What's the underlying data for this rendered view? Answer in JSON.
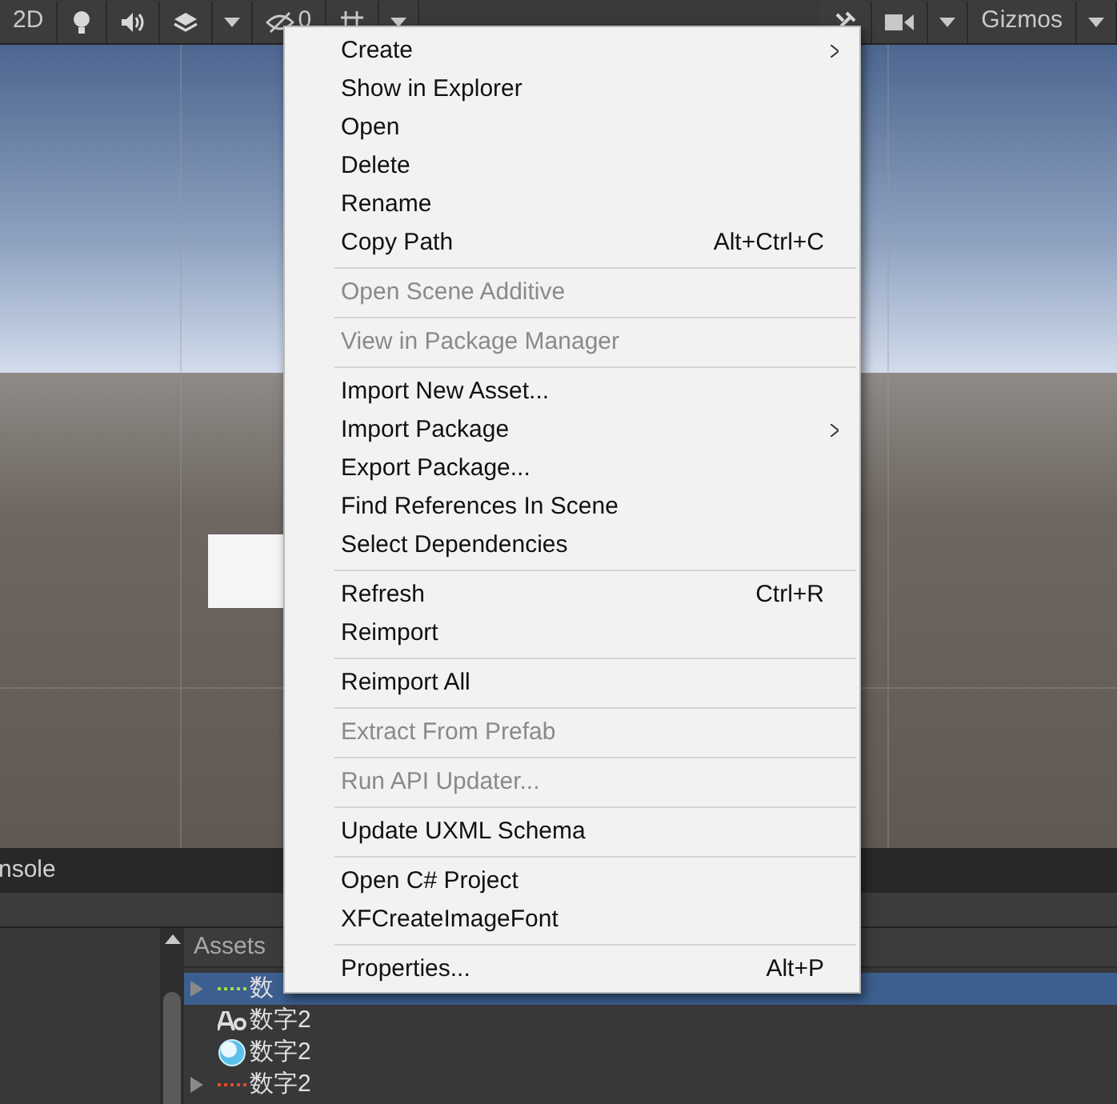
{
  "toolbar": {
    "left": [
      {
        "kind": "text",
        "label": "2D"
      },
      {
        "kind": "bulb"
      },
      {
        "kind": "speaker"
      },
      {
        "kind": "layers"
      },
      {
        "kind": "dropdown"
      },
      {
        "kind": "hidden",
        "label": "0"
      },
      {
        "kind": "grid"
      },
      {
        "kind": "dropdown"
      }
    ],
    "right": [
      {
        "kind": "tools"
      },
      {
        "kind": "camera"
      },
      {
        "kind": "dropdown"
      },
      {
        "kind": "text",
        "label": "Gizmos"
      },
      {
        "kind": "dropdown"
      }
    ]
  },
  "context_menu": [
    {
      "kind": "item",
      "label": "Create",
      "submenu": true,
      "disabled": false
    },
    {
      "kind": "item",
      "label": "Show in Explorer",
      "disabled": false
    },
    {
      "kind": "item",
      "label": "Open",
      "disabled": false
    },
    {
      "kind": "item",
      "label": "Delete",
      "disabled": false
    },
    {
      "kind": "item",
      "label": "Rename",
      "disabled": false
    },
    {
      "kind": "item",
      "label": "Copy Path",
      "shortcut": "Alt+Ctrl+C",
      "disabled": false
    },
    {
      "kind": "separator"
    },
    {
      "kind": "item",
      "label": "Open Scene Additive",
      "disabled": true
    },
    {
      "kind": "separator"
    },
    {
      "kind": "item",
      "label": "View in Package Manager",
      "disabled": true
    },
    {
      "kind": "separator"
    },
    {
      "kind": "item",
      "label": "Import New Asset...",
      "disabled": false
    },
    {
      "kind": "item",
      "label": "Import Package",
      "submenu": true,
      "disabled": false
    },
    {
      "kind": "item",
      "label": "Export Package...",
      "disabled": false
    },
    {
      "kind": "item",
      "label": "Find References In Scene",
      "disabled": false
    },
    {
      "kind": "item",
      "label": "Select Dependencies",
      "disabled": false
    },
    {
      "kind": "separator"
    },
    {
      "kind": "item",
      "label": "Refresh",
      "shortcut": "Ctrl+R",
      "disabled": false
    },
    {
      "kind": "item",
      "label": "Reimport",
      "disabled": false
    },
    {
      "kind": "separator"
    },
    {
      "kind": "item",
      "label": "Reimport All",
      "disabled": false
    },
    {
      "kind": "separator"
    },
    {
      "kind": "item",
      "label": "Extract From Prefab",
      "disabled": true
    },
    {
      "kind": "separator"
    },
    {
      "kind": "item",
      "label": "Run API Updater...",
      "disabled": true
    },
    {
      "kind": "separator"
    },
    {
      "kind": "item",
      "label": "Update UXML Schema",
      "disabled": false
    },
    {
      "kind": "separator"
    },
    {
      "kind": "item",
      "label": "Open C# Project",
      "disabled": false
    },
    {
      "kind": "item",
      "label": "XFCreateImageFont",
      "disabled": false
    },
    {
      "kind": "separator"
    },
    {
      "kind": "item",
      "label": "Properties...",
      "shortcut": "Alt+P",
      "disabled": false
    }
  ],
  "bottom_panel": {
    "tab": "nsole",
    "assets_header": "Assets",
    "assets": [
      {
        "label": "数",
        "kind": "sprite-green",
        "expandable": true,
        "selected": true
      },
      {
        "label": "数字2",
        "kind": "font",
        "expandable": false,
        "selected": false
      },
      {
        "label": "数字2",
        "kind": "material",
        "expandable": false,
        "selected": false
      },
      {
        "label": "数字2",
        "kind": "sprite-red",
        "expandable": true,
        "selected": false
      }
    ]
  }
}
